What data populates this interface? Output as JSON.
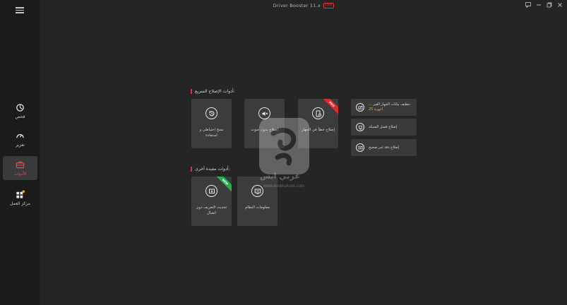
{
  "window": {
    "title": "Driver Booster 11.x",
    "pro_badge": "PRO",
    "controls": [
      "feedback-icon",
      "minimize-icon",
      "restore-icon",
      "close-icon"
    ]
  },
  "sidebar": {
    "items": [
      {
        "label": "فحص",
        "icon": "scan-icon",
        "active": false
      },
      {
        "label": "تعزيز",
        "icon": "boost-icon",
        "active": false
      },
      {
        "label": "الأدوات",
        "icon": "toolbox-icon",
        "active": true
      },
      {
        "label": "مركز العمل",
        "icon": "action-center-icon",
        "active": false
      }
    ]
  },
  "sections": {
    "quick_fix": "أدوات الإصلاح السريع:",
    "other_tools": "أدوات مفيدة أخرى:"
  },
  "quick_fix_cards": [
    {
      "label": "نسخ احتياطي و استعادة",
      "icon": "restore-icon"
    },
    {
      "label": "إصلاح بدون صوت",
      "icon": "mute-icon"
    },
    {
      "label": "إصلاح خطأ في الجهاز",
      "icon": "device-error-icon",
      "ribbon": "PRO"
    }
  ],
  "mini_tools": [
    {
      "label": "... تنظيف بيانات الجهاز الغير",
      "sub": "أجهزة 25",
      "icon": "clean-device-icon"
    },
    {
      "label": "إصلاح فشل الشبكة",
      "icon": "network-icon"
    },
    {
      "label": "إصلاح دقة غير صحيح",
      "icon": "resolution-icon"
    }
  ],
  "other_cards": [
    {
      "label": "تحديث التعريف دون اتصال",
      "icon": "offline-update-icon",
      "ribbon": "NEW"
    },
    {
      "label": "معلومات النظام",
      "icon": "system-info-icon"
    }
  ],
  "watermark": {
    "text": "عربي ايس",
    "subtext": "www.ArabicAces.com"
  },
  "colors": {
    "accent": "#e03838",
    "pro": "#e02a2a",
    "new": "#21b04b",
    "mini_sub": "#e9a63a"
  }
}
